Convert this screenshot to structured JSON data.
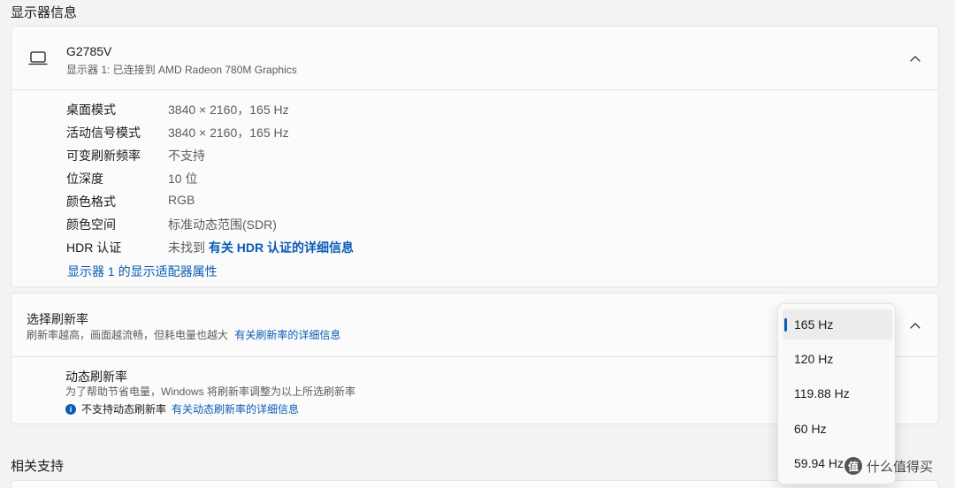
{
  "sections": {
    "display_info": "显示器信息",
    "related_support": "相关支持"
  },
  "monitor": {
    "icon": "laptop-icon",
    "name": "G2785V",
    "subtitle": "显示器 1: 已连接到 AMD Radeon 780M Graphics",
    "rows": [
      {
        "label": "桌面模式",
        "value": "3840 × 2160，165 Hz"
      },
      {
        "label": "活动信号模式",
        "value": "3840 × 2160，165 Hz"
      },
      {
        "label": "可变刷新频率",
        "value": "不支持"
      },
      {
        "label": "位深度",
        "value": "10 位"
      },
      {
        "label": "颜色格式",
        "value": "RGB"
      },
      {
        "label": "颜色空间",
        "value": "标准动态范围(SDR)"
      },
      {
        "label": "HDR 认证",
        "value": "未找到",
        "link": "有关 HDR 认证的详细信息"
      }
    ],
    "adapter_link": "显示器 1 的显示适配器属性"
  },
  "refresh": {
    "title": "选择刷新率",
    "subtitle": "刷新率越高，画面越流畅，但耗电量也越大",
    "subtitle_link": "有关刷新率的详细信息",
    "dynamic_title": "动态刷新率",
    "dynamic_sub": "为了帮助节省电量，Windows 将刷新率调整为以上所选刷新率",
    "dynamic_note": "不支持动态刷新率",
    "dynamic_note_link": "有关动态刷新率的详细信息",
    "options": [
      "165 Hz",
      "120 Hz",
      "119.88 Hz",
      "60 Hz",
      "59.94 Hz"
    ],
    "selected": "165 Hz"
  },
  "watermark": {
    "icon": "值",
    "text": "什么值得买"
  },
  "colors": {
    "accent": "#0a5bb5",
    "background": "#f3f3f3",
    "card": "#fbfbfb"
  }
}
